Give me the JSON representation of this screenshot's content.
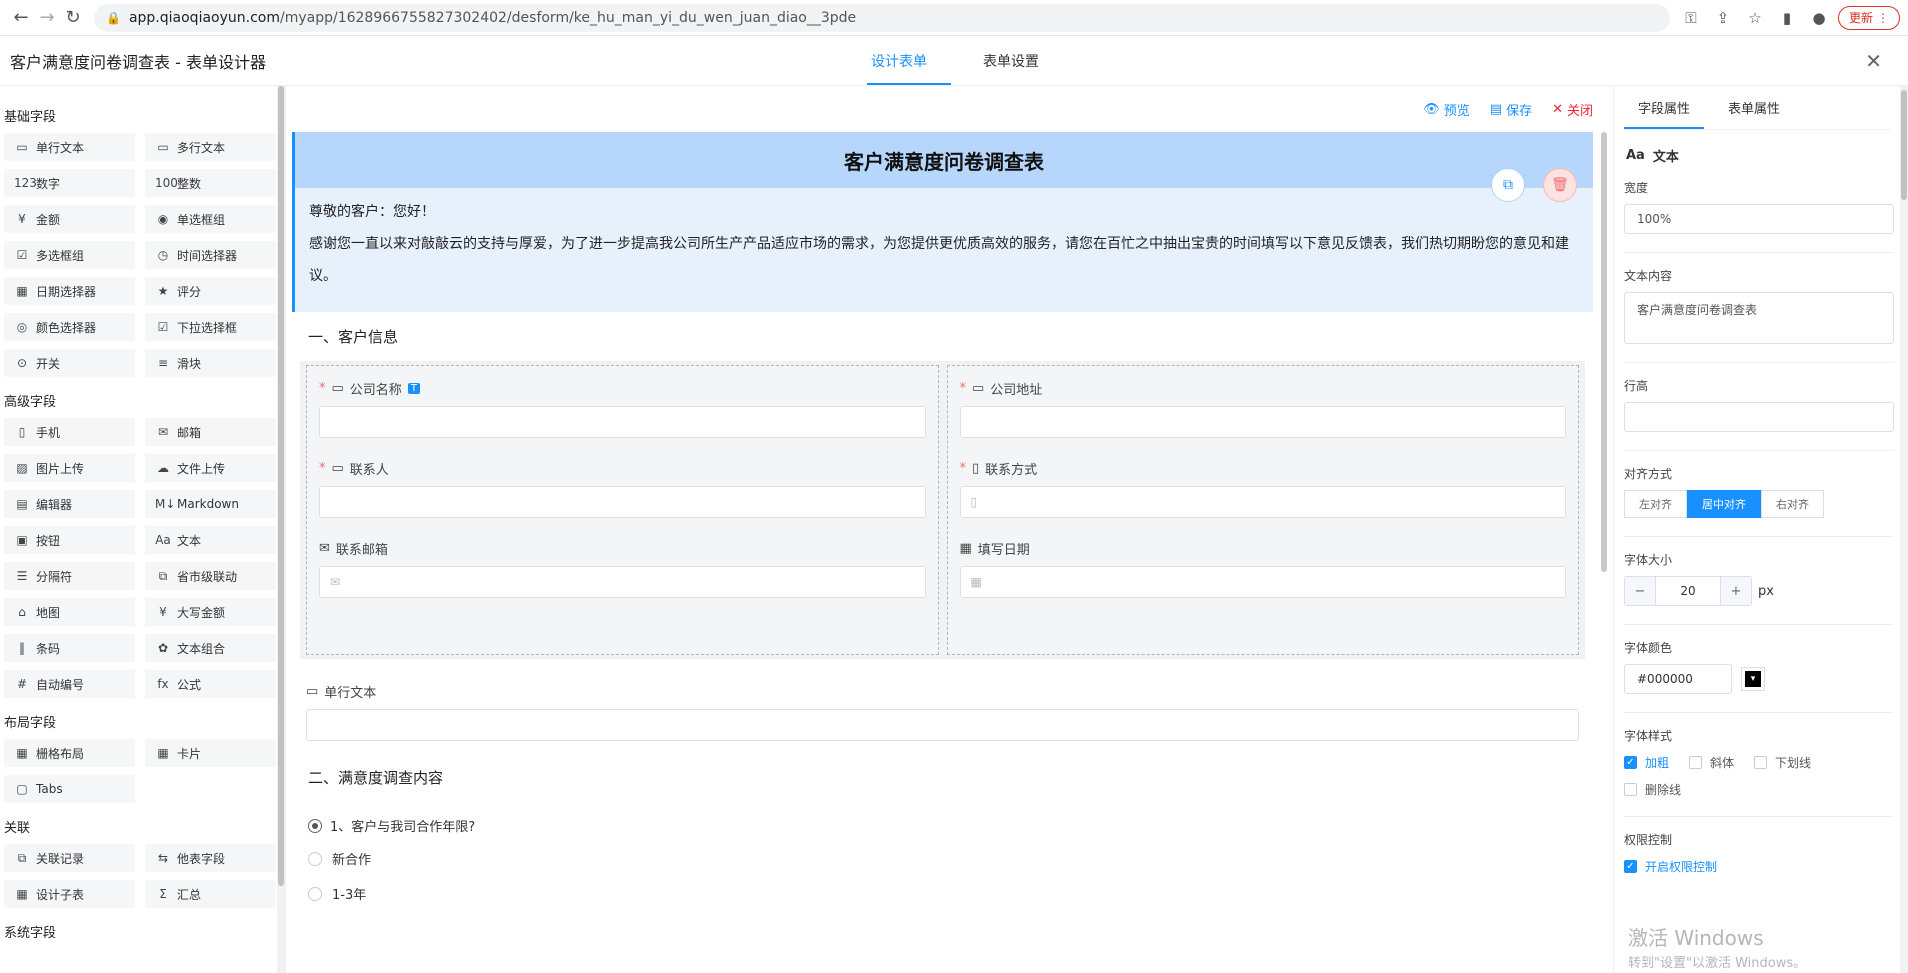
{
  "browser": {
    "url_host": "app.qiaoqiaoyun.com",
    "url_path": "/myapp/1628966755827302402/desform/ke_hu_man_yi_du_wen_juan_diao__3pde",
    "update_label": "更新"
  },
  "app": {
    "title": "客户满意度问卷调查表 - 表单设计器",
    "tabs": [
      "设计表单",
      "表单设置"
    ]
  },
  "palette": {
    "groups": [
      {
        "title": "基础字段",
        "items": [
          {
            "label": "单行文本",
            "icon": "▭"
          },
          {
            "label": "多行文本",
            "icon": "▭"
          },
          {
            "label": "数字",
            "icon": "123"
          },
          {
            "label": "整数",
            "icon": "100"
          },
          {
            "label": "金额",
            "icon": "¥"
          },
          {
            "label": "单选框组",
            "icon": "◉"
          },
          {
            "label": "多选框组",
            "icon": "☑"
          },
          {
            "label": "时间选择器",
            "icon": "◷"
          },
          {
            "label": "日期选择器",
            "icon": "▦"
          },
          {
            "label": "评分",
            "icon": "★"
          },
          {
            "label": "颜色选择器",
            "icon": "◎"
          },
          {
            "label": "下拉选择框",
            "icon": "☑"
          },
          {
            "label": "开关",
            "icon": "⊙"
          },
          {
            "label": "滑块",
            "icon": "≡"
          }
        ]
      },
      {
        "title": "高级字段",
        "items": [
          {
            "label": "手机",
            "icon": "▯"
          },
          {
            "label": "邮箱",
            "icon": "✉"
          },
          {
            "label": "图片上传",
            "icon": "▨"
          },
          {
            "label": "文件上传",
            "icon": "☁"
          },
          {
            "label": "编辑器",
            "icon": "▤"
          },
          {
            "label": "Markdown",
            "icon": "M↓"
          },
          {
            "label": "按钮",
            "icon": "▣"
          },
          {
            "label": "文本",
            "icon": "Aa"
          },
          {
            "label": "分隔符",
            "icon": "☰"
          },
          {
            "label": "省市级联动",
            "icon": "⧉"
          },
          {
            "label": "地图",
            "icon": "⌂"
          },
          {
            "label": "大写金额",
            "icon": "¥"
          },
          {
            "label": "条码",
            "icon": "‖"
          },
          {
            "label": "文本组合",
            "icon": "✿"
          },
          {
            "label": "自动编号",
            "icon": "#"
          },
          {
            "label": "公式",
            "icon": "fx"
          }
        ]
      },
      {
        "title": "布局字段",
        "items": [
          {
            "label": "栅格布局",
            "icon": "▦"
          },
          {
            "label": "卡片",
            "icon": "▦"
          },
          {
            "label": "Tabs",
            "icon": "▢"
          }
        ]
      },
      {
        "title": "关联",
        "items": [
          {
            "label": "关联记录",
            "icon": "⧉"
          },
          {
            "label": "他表字段",
            "icon": "⇆"
          },
          {
            "label": "设计子表",
            "icon": "▦"
          },
          {
            "label": "汇总",
            "icon": "Σ"
          }
        ]
      },
      {
        "title": "系统字段",
        "items": []
      }
    ]
  },
  "canvas": {
    "toolbar": {
      "preview": "预览",
      "save": "保存",
      "close": "关闭"
    },
    "form_title": "客户满意度问卷调查表",
    "greeting": "尊敬的客户：您好！",
    "intro": "感谢您一直以来对敲敲云的支持与厚爱，为了进一步提高我公司所生产产品适应市场的需求，为您提供更优质高效的服务，请您在百忙之中抽出宝贵的时间填写以下意见反馈表，我们热切期盼您的意见和建议。",
    "section1": "一、客户信息",
    "fields": {
      "company_name": "公司名称",
      "company_address": "公司地址",
      "contact": "联系人",
      "contact_phone": "联系方式",
      "contact_email": "联系邮箱",
      "fill_date": "填写日期",
      "badge": "T"
    },
    "single_text_label": "单行文本",
    "section2": "二、满意度调查内容",
    "question1": "1、客户与我司合作年限?",
    "options": [
      "新合作",
      "1-3年"
    ]
  },
  "props": {
    "tabs": [
      "字段属性",
      "表单属性"
    ],
    "component": "文本",
    "width_label": "宽度",
    "width_value": "100%",
    "content_label": "文本内容",
    "content_value": "客户满意度问卷调查表",
    "line_height_label": "行高",
    "line_height_value": "",
    "align_label": "对齐方式",
    "align_options": [
      "左对齐",
      "居中对齐",
      "右对齐"
    ],
    "align_selected": "居中对齐",
    "font_size_label": "字体大小",
    "font_size_value": "20",
    "font_size_unit": "px",
    "font_color_label": "字体颜色",
    "font_color_value": "#000000",
    "font_style_label": "字体样式",
    "styles": {
      "bold": "加粗",
      "italic": "斜体",
      "underline": "下划线",
      "strike": "删除线"
    },
    "permission_label": "权限控制",
    "permission_enable": "开启权限控制"
  },
  "watermark": {
    "line1": "激活 Windows",
    "line2": "转到\"设置\"以激活 Windows。"
  },
  "colors": {
    "accent": "#1890ff",
    "danger": "#f5222d",
    "title_bg": "#b6d7fb"
  }
}
